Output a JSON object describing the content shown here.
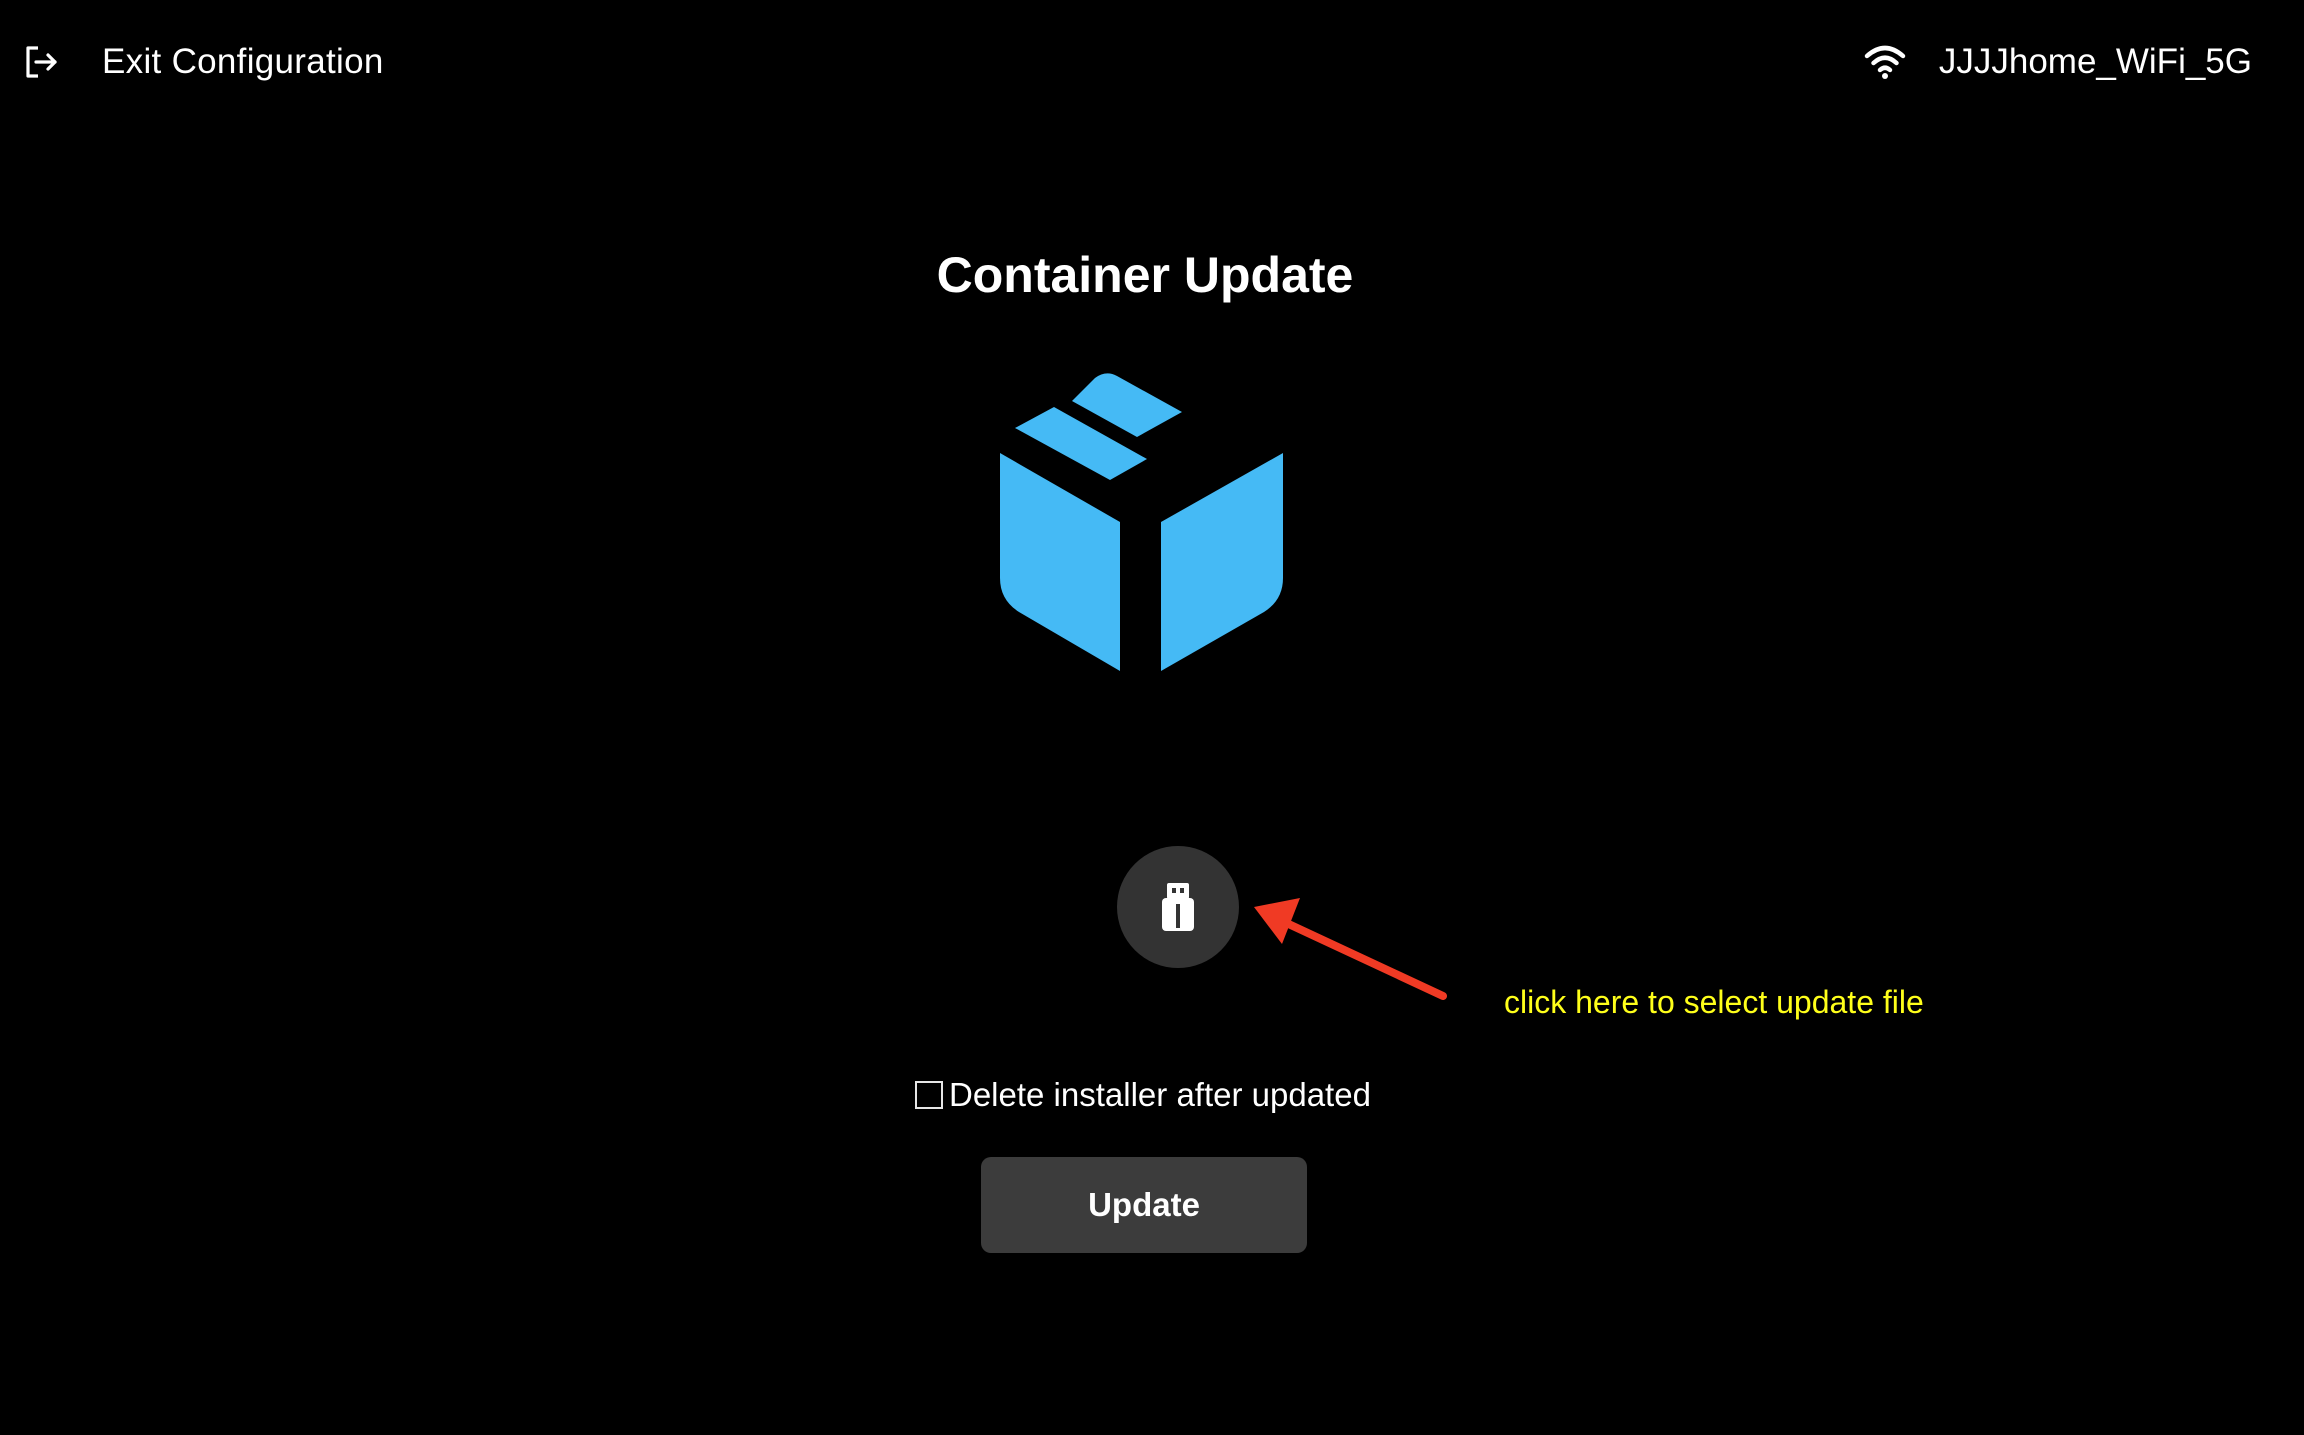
{
  "header": {
    "exit_label": "Exit Configuration",
    "exit_icon": "exit-icon",
    "wifi_icon": "wifi-icon",
    "wifi_name": "JJJJhome_WiFi_5G"
  },
  "main": {
    "title": "Container Update",
    "package_icon": "package-box-icon",
    "package_icon_color": "#45baf5",
    "usb_icon": "usb-drive-icon",
    "annotation_text": "click here to select update file",
    "annotation_color": "#ffff1a",
    "arrow_color": "#f03a24",
    "checkbox_label": "Delete installer after updated",
    "checkbox_checked": false,
    "update_button_label": "Update"
  }
}
